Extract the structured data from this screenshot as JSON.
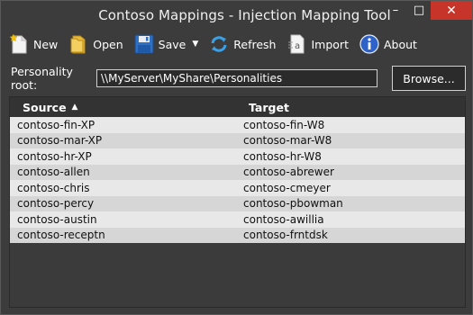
{
  "window": {
    "title": "Contoso Mappings - Injection Mapping Tool",
    "minimize_glyph": "–",
    "maximize_glyph": "□",
    "close_glyph": "✕"
  },
  "toolbar": {
    "new_label": "New",
    "open_label": "Open",
    "save_label": "Save",
    "refresh_label": "Refresh",
    "import_label": "Import",
    "about_label": "About"
  },
  "personality_root": {
    "label": "Personality root:",
    "value": "\\\\MyServer\\MyShare\\Personalities",
    "browse_label": "Browse..."
  },
  "grid": {
    "columns": [
      "Source",
      "Target"
    ],
    "sort_glyph": "▲",
    "rows": [
      {
        "source": "contoso-fin-XP",
        "target": "contoso-fin-W8"
      },
      {
        "source": "contoso-mar-XP",
        "target": "contoso-mar-W8"
      },
      {
        "source": "contoso-hr-XP",
        "target": "contoso-hr-W8"
      },
      {
        "source": "contoso-allen",
        "target": "contoso-abrewer"
      },
      {
        "source": "contoso-chris",
        "target": "contoso-cmeyer"
      },
      {
        "source": "contoso-percy",
        "target": "contoso-pbowman"
      },
      {
        "source": "contoso-austin",
        "target": "contoso-awillia"
      },
      {
        "source": "contoso-receptn",
        "target": "contoso-frntdsk"
      }
    ]
  },
  "colors": {
    "window_bg": "#3c3c3c",
    "close_button": "#c7342a",
    "row_light": "#e8e8e8",
    "row_dark": "#d6d6d6"
  },
  "icons": {
    "new": "new-document-icon",
    "open": "folder-icon",
    "save": "floppy-disk-icon",
    "refresh": "refresh-arrows-icon",
    "import": "import-document-icon",
    "about": "info-icon"
  }
}
